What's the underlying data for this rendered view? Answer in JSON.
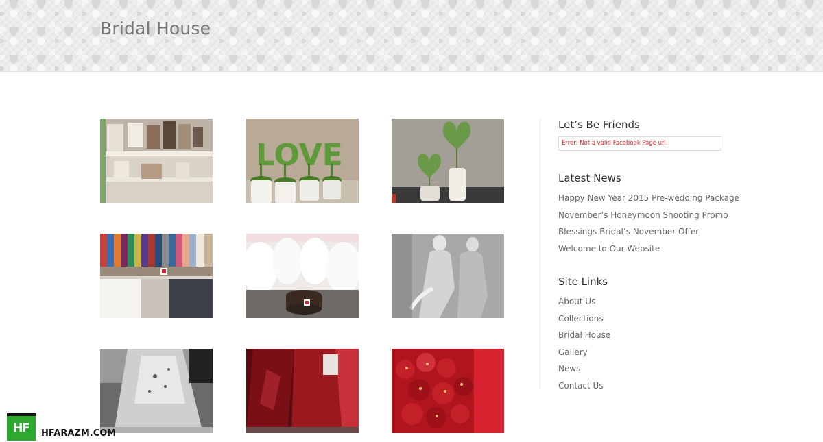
{
  "header": {
    "site_title": "Bridal House"
  },
  "gallery": {
    "items": [
      {
        "name": "photo-frames-shelf"
      },
      {
        "name": "love-topiary"
      },
      {
        "name": "heart-topiary"
      },
      {
        "name": "suits-rack"
      },
      {
        "name": "white-gowns-room"
      },
      {
        "name": "mannequins-bw"
      },
      {
        "name": "gown-detail-bw"
      },
      {
        "name": "red-dress"
      },
      {
        "name": "red-embroidery"
      }
    ]
  },
  "sidebar": {
    "friends": {
      "title": "Let’s Be Friends",
      "error": "Error: Not a valid Facebook Page url."
    },
    "news": {
      "title": "Latest News",
      "items": [
        "Happy New Year 2015 Pre-wedding Package",
        "November’s Honeymoon Shooting Promo",
        "Blessings Bridal’s November Offer",
        "Welcome to Our Website"
      ]
    },
    "links": {
      "title": "Site Links",
      "items": [
        "About Us",
        "Collections",
        "Bridal House",
        "Gallery",
        "News",
        "Contact Us"
      ]
    }
  },
  "watermark": {
    "logo": "HF",
    "text": "HFARAZM.COM"
  }
}
